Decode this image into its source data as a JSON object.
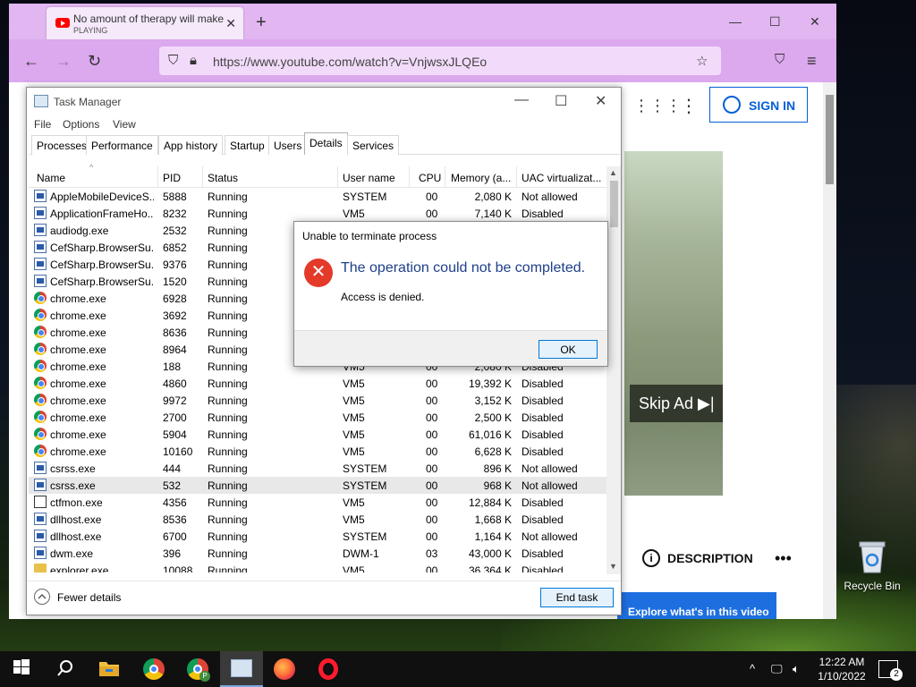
{
  "browser": {
    "tab": {
      "title": "No amount of therapy will make",
      "status": "PLAYING"
    },
    "url": "https://www.youtube.com/watch?v=VnjwsxJLQEo",
    "page": {
      "sign_in": "SIGN IN",
      "skip_ad": "Skip Ad ▶|",
      "description": "DESCRIPTION",
      "explore": "Explore what's in this video"
    }
  },
  "task_manager": {
    "title": "Task Manager",
    "menu": [
      "File",
      "Options",
      "View"
    ],
    "tabs": [
      "Processes",
      "Performance",
      "App history",
      "Startup",
      "Users",
      "Details",
      "Services"
    ],
    "active_tab": "Details",
    "columns": [
      "Name",
      "PID",
      "Status",
      "User name",
      "CPU",
      "Memory (a...",
      "UAC virtualizat..."
    ],
    "rows": [
      {
        "icon": "win",
        "name": "AppleMobileDeviceS...",
        "pid": "5888",
        "status": "Running",
        "user": "SYSTEM",
        "cpu": "00",
        "mem": "2,080 K",
        "uac": "Not allowed"
      },
      {
        "icon": "win",
        "name": "ApplicationFrameHo...",
        "pid": "8232",
        "status": "Running",
        "user": "VM5",
        "cpu": "00",
        "mem": "7,140 K",
        "uac": "Disabled"
      },
      {
        "icon": "win",
        "name": "audiodg.exe",
        "pid": "2532",
        "status": "Running",
        "user": "",
        "cpu": "",
        "mem": "",
        "uac": ""
      },
      {
        "icon": "win",
        "name": "CefSharp.BrowserSu...",
        "pid": "6852",
        "status": "Running",
        "user": "",
        "cpu": "",
        "mem": "",
        "uac": ""
      },
      {
        "icon": "win",
        "name": "CefSharp.BrowserSu...",
        "pid": "9376",
        "status": "Running",
        "user": "",
        "cpu": "",
        "mem": "",
        "uac": ""
      },
      {
        "icon": "win",
        "name": "CefSharp.BrowserSu...",
        "pid": "1520",
        "status": "Running",
        "user": "",
        "cpu": "",
        "mem": "",
        "uac": ""
      },
      {
        "icon": "chrome",
        "name": "chrome.exe",
        "pid": "6928",
        "status": "Running",
        "user": "",
        "cpu": "",
        "mem": "",
        "uac": ""
      },
      {
        "icon": "chrome",
        "name": "chrome.exe",
        "pid": "3692",
        "status": "Running",
        "user": "",
        "cpu": "",
        "mem": "",
        "uac": ""
      },
      {
        "icon": "chrome",
        "name": "chrome.exe",
        "pid": "8636",
        "status": "Running",
        "user": "",
        "cpu": "",
        "mem": "",
        "uac": ""
      },
      {
        "icon": "chrome",
        "name": "chrome.exe",
        "pid": "8964",
        "status": "Running",
        "user": "",
        "cpu": "",
        "mem": "",
        "uac": ""
      },
      {
        "icon": "chrome",
        "name": "chrome.exe",
        "pid": "188",
        "status": "Running",
        "user": "VM5",
        "cpu": "00",
        "mem": "2,080 K",
        "uac": "Disabled"
      },
      {
        "icon": "chrome",
        "name": "chrome.exe",
        "pid": "4860",
        "status": "Running",
        "user": "VM5",
        "cpu": "00",
        "mem": "19,392 K",
        "uac": "Disabled"
      },
      {
        "icon": "chrome",
        "name": "chrome.exe",
        "pid": "9972",
        "status": "Running",
        "user": "VM5",
        "cpu": "00",
        "mem": "3,152 K",
        "uac": "Disabled"
      },
      {
        "icon": "chrome",
        "name": "chrome.exe",
        "pid": "2700",
        "status": "Running",
        "user": "VM5",
        "cpu": "00",
        "mem": "2,500 K",
        "uac": "Disabled"
      },
      {
        "icon": "chrome",
        "name": "chrome.exe",
        "pid": "5904",
        "status": "Running",
        "user": "VM5",
        "cpu": "00",
        "mem": "61,016 K",
        "uac": "Disabled"
      },
      {
        "icon": "chrome",
        "name": "chrome.exe",
        "pid": "10160",
        "status": "Running",
        "user": "VM5",
        "cpu": "00",
        "mem": "6,628 K",
        "uac": "Disabled"
      },
      {
        "icon": "win",
        "name": "csrss.exe",
        "pid": "444",
        "status": "Running",
        "user": "SYSTEM",
        "cpu": "00",
        "mem": "896 K",
        "uac": "Not allowed"
      },
      {
        "icon": "win",
        "name": "csrss.exe",
        "pid": "532",
        "status": "Running",
        "user": "SYSTEM",
        "cpu": "00",
        "mem": "968 K",
        "uac": "Not allowed",
        "selected": true
      },
      {
        "icon": "pen",
        "name": "ctfmon.exe",
        "pid": "4356",
        "status": "Running",
        "user": "VM5",
        "cpu": "00",
        "mem": "12,884 K",
        "uac": "Disabled"
      },
      {
        "icon": "win",
        "name": "dllhost.exe",
        "pid": "8536",
        "status": "Running",
        "user": "VM5",
        "cpu": "00",
        "mem": "1,668 K",
        "uac": "Disabled"
      },
      {
        "icon": "win",
        "name": "dllhost.exe",
        "pid": "6700",
        "status": "Running",
        "user": "SYSTEM",
        "cpu": "00",
        "mem": "1,164 K",
        "uac": "Not allowed"
      },
      {
        "icon": "win",
        "name": "dwm.exe",
        "pid": "396",
        "status": "Running",
        "user": "DWM-1",
        "cpu": "03",
        "mem": "43,000 K",
        "uac": "Disabled"
      },
      {
        "icon": "folder",
        "name": "explorer.exe",
        "pid": "10088",
        "status": "Running",
        "user": "VM5",
        "cpu": "00",
        "mem": "36,364 K",
        "uac": "Disabled"
      }
    ],
    "footer": {
      "fewer_details": "Fewer details",
      "end_task": "End task"
    }
  },
  "error_dialog": {
    "title": "Unable to terminate process",
    "message": "The operation could not be completed.",
    "detail": "Access is denied.",
    "ok": "OK"
  },
  "desktop": {
    "recycle_bin": "Recycle Bin"
  },
  "taskbar": {
    "time": "12:22 AM",
    "date": "1/10/2022",
    "notifications": "2"
  }
}
